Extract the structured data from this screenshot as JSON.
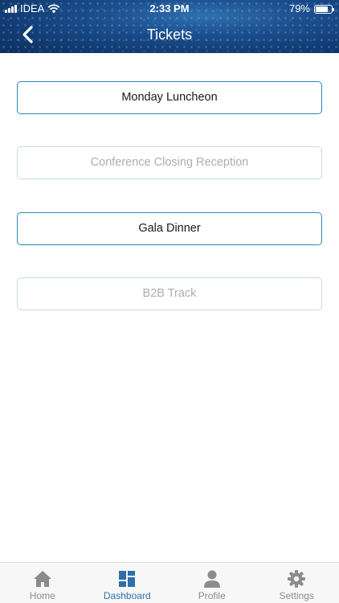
{
  "status_bar": {
    "carrier": "IDEA",
    "time": "2:33 PM",
    "battery_percent": "79%",
    "battery_level": 0.79
  },
  "header": {
    "title": "Tickets",
    "back_icon": "chevron-left-icon"
  },
  "tickets": [
    {
      "label": "Monday Luncheon",
      "enabled": true
    },
    {
      "label": "Conference Closing Reception",
      "enabled": false
    },
    {
      "label": "Gala Dinner",
      "enabled": true
    },
    {
      "label": "B2B Track",
      "enabled": false
    }
  ],
  "tabbar": {
    "items": [
      {
        "label": "Home",
        "icon": "home-icon",
        "selected": false
      },
      {
        "label": "Dashboard",
        "icon": "dashboard-icon",
        "selected": true
      },
      {
        "label": "Profile",
        "icon": "profile-icon",
        "selected": false
      },
      {
        "label": "Settings",
        "icon": "gear-icon",
        "selected": false
      }
    ]
  },
  "colors": {
    "accent": "#2f6fa8",
    "button_border": "#2a88b8",
    "disabled_text": "#a9aeb3",
    "icon_inactive": "#8c8c8c"
  }
}
